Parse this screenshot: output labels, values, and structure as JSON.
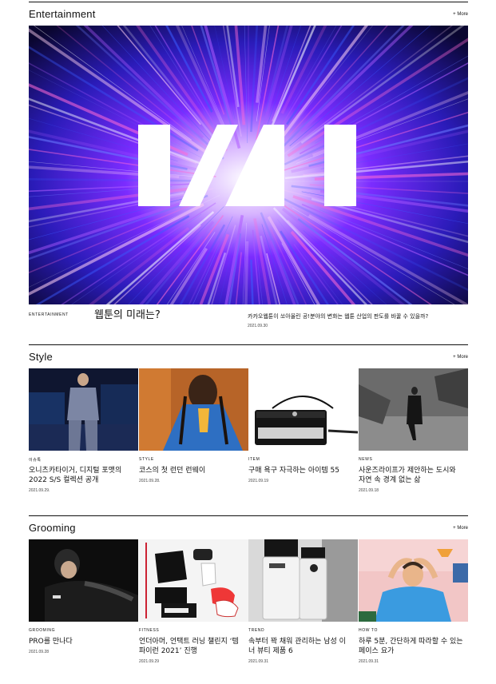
{
  "sections": {
    "entertainment": {
      "title": "Entertainment",
      "more": "+ More",
      "hero_category": "ENTERTAINMENT",
      "hero_title": "웹툰의 미래는?",
      "hero_desc": "카카오웹툰이 쏘아올린 공!분야의 변화는 웹툰 산업의 판도를 바꿀 수 있을까?",
      "hero_date": "2021.09.30"
    },
    "style": {
      "title": "Style",
      "more": "+ More",
      "items": [
        {
          "category": "이슈톡",
          "title": "오니츠카타이거, 디지털 포맷의 2022 S/S 컬렉션 공개",
          "date": "2021.09.29."
        },
        {
          "category": "STYLE",
          "title": "코스의 첫 런던 런웨이",
          "date": "2021.09.28."
        },
        {
          "category": "ITEM",
          "title": "구매 욕구 자극하는 아이템 55",
          "date": "2021.09.19"
        },
        {
          "category": "NEWS",
          "title": "사운즈라이프가 제안하는 도시와 자연 속 경계 없는 삶",
          "date": "2021.09.18"
        }
      ]
    },
    "grooming": {
      "title": "Grooming",
      "more": "+ More",
      "items": [
        {
          "category": "GROOMING",
          "title": "PRO를 만나다",
          "date": "2021.09.28"
        },
        {
          "category": "FITNESS",
          "title": "언더아머, 언택트 러닝 챌린지 ‘템파이런 2021’ 진행",
          "date": "2021.09.29"
        },
        {
          "category": "TREND",
          "title": "속부터 꽉 채워 관리하는 남성 이너 뷰티 제품 6",
          "date": "2021.09.31"
        },
        {
          "category": "HOW TO",
          "title": "하루 5분, 간단하게 따라할 수 있는 페이스 요가",
          "date": "2021.09.31"
        }
      ]
    }
  },
  "colors": {
    "text": "#111111",
    "rule": "#111111",
    "hero_bg": "#1a0b4a"
  },
  "icons": [
    "hero-logo-icon"
  ]
}
